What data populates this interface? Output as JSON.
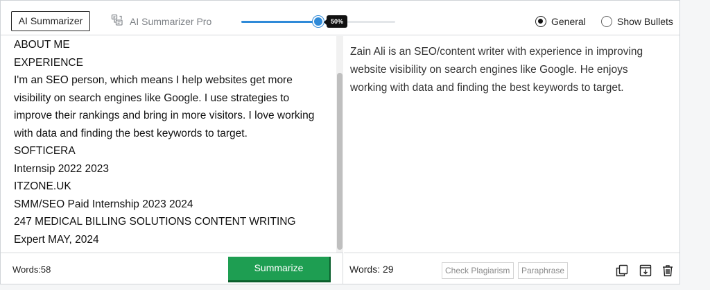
{
  "header": {
    "tab_basic": "AI Summarizer",
    "tab_pro": "AI Summarizer Pro",
    "slider": {
      "value_percent": 50,
      "label": "50%"
    },
    "mode_options": [
      {
        "label": "General",
        "selected": true
      },
      {
        "label": "Show Bullets",
        "selected": false
      }
    ]
  },
  "input": {
    "lines": [
      "ABOUT ME",
      "EXPERIENCE",
      "I'm an SEO person, which means I help websites get more",
      "visibility on search engines like Google. I use strategies to",
      "improve their rankings and bring in more visitors. I love working",
      "with data and finding the best keywords to target.",
      "SOFTICERA",
      "Internsip 2022 2023",
      "ITZONE.UK",
      "SMM/SEO Paid Internship 2023 2024",
      "247 MEDICAL BILLING SOLUTIONS CONTENT WRITING",
      "Expert MAY, 2024"
    ],
    "word_count": "Words:58",
    "summarize_label": "Summarize"
  },
  "output": {
    "text": "Zain Ali is an SEO/content writer with experience in improving website visibility on search engines like Google. He enjoys working with data and finding the best keywords to target.",
    "word_count": "Words: 29",
    "check_plagiarism_label": "Check Plagiarism",
    "paraphrase_label": "Paraphrase",
    "icons": [
      "copy-icon",
      "download-icon",
      "trash-icon"
    ]
  },
  "colors": {
    "accent": "#2f8ad8",
    "summarize_button": "#1e9e52"
  }
}
